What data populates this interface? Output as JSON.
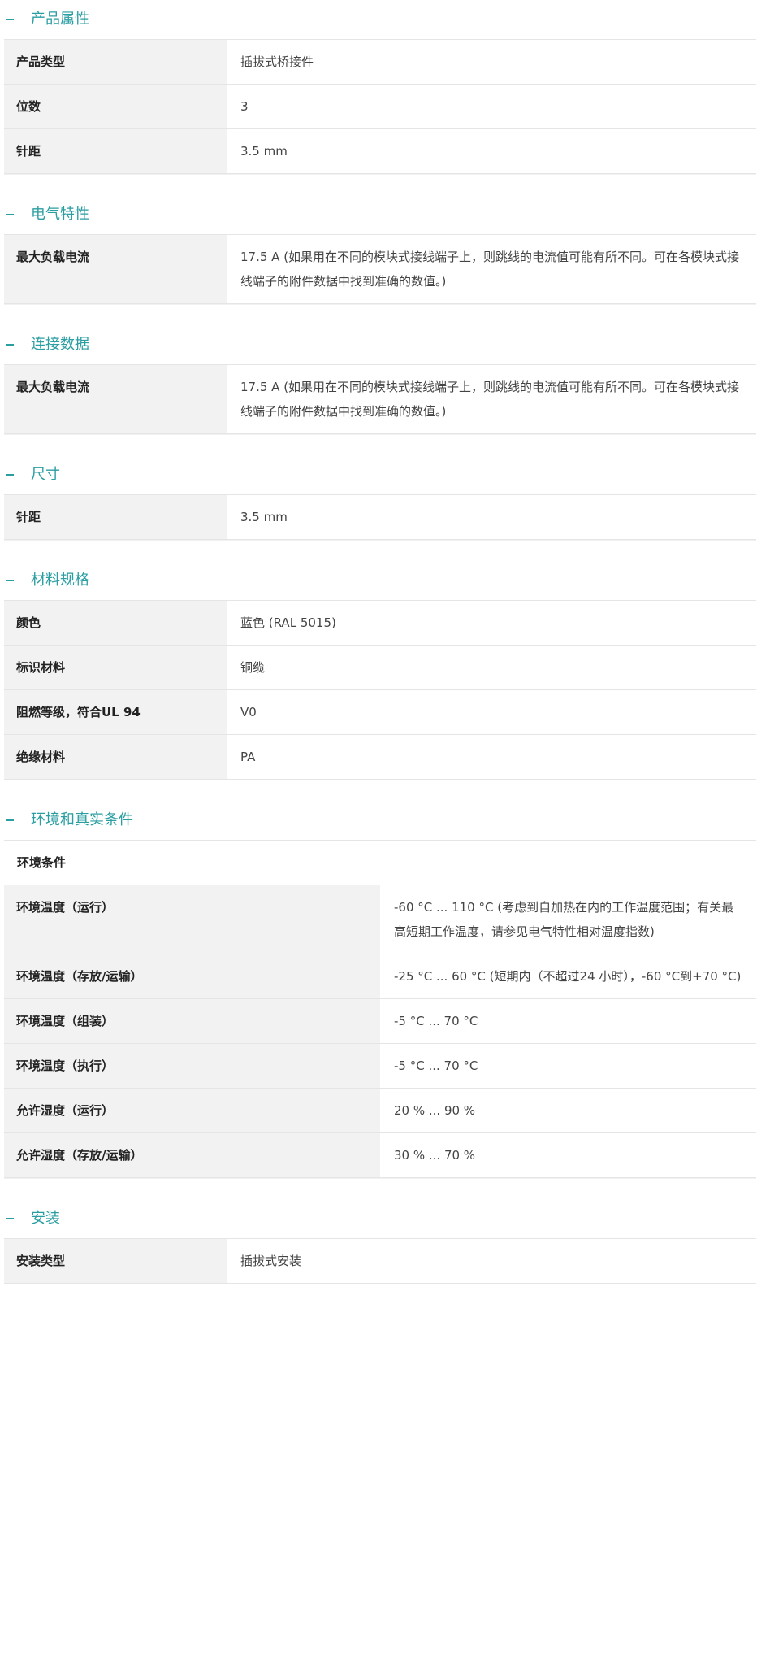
{
  "sections": [
    {
      "title": "产品属性",
      "rows": [
        {
          "label": "产品类型",
          "value": "插拔式桥接件"
        },
        {
          "label": "位数",
          "value": "3"
        },
        {
          "label": "针距",
          "value": "3.5 mm"
        }
      ]
    },
    {
      "title": "电气特性",
      "rows": [
        {
          "label": "最大负载电流",
          "value": "17.5 A (如果用在不同的模块式接线端子上，则跳线的电流值可能有所不同。可在各模块式接线端子的附件数据中找到准确的数值。)"
        }
      ]
    },
    {
      "title": "连接数据",
      "rows": [
        {
          "label": "最大负载电流",
          "value": "17.5 A (如果用在不同的模块式接线端子上，则跳线的电流值可能有所不同。可在各模块式接线端子的附件数据中找到准确的数值。)"
        }
      ]
    },
    {
      "title": "尺寸",
      "rows": [
        {
          "label": "针距",
          "value": "3.5 mm"
        }
      ]
    },
    {
      "title": "材料规格",
      "rows": [
        {
          "label": "颜色",
          "value": "蓝色 (RAL 5015)"
        },
        {
          "label": "标识材料",
          "value": "铜缆"
        },
        {
          "label": "阻燃等级，符合UL 94",
          "value": "V0"
        },
        {
          "label": "绝缘材料",
          "value": "PA"
        }
      ]
    },
    {
      "title": "环境和真实条件",
      "subheading": "环境条件",
      "rows": [
        {
          "label": "环境温度（运行）",
          "value": "-60 °C ... 110 °C (考虑到自加热在内的工作温度范围；有关最高短期工作温度，请参见电气特性相对温度指数)"
        },
        {
          "label": "环境温度（存放/运输）",
          "value": "-25 °C ... 60 °C (短期内（不超过24 小时），-60 °C到+70 °C)"
        },
        {
          "label": "环境温度（组装）",
          "value": "-5 °C ... 70 °C"
        },
        {
          "label": "环境温度（执行）",
          "value": "-5 °C ... 70 °C"
        },
        {
          "label": "允许湿度（运行）",
          "value": "20 % ... 90 %"
        },
        {
          "label": "允许湿度（存放/运输）",
          "value": "30 % ... 70 %"
        }
      ]
    },
    {
      "title": "安装",
      "rows": [
        {
          "label": "安装类型",
          "value": "插拔式安装"
        }
      ]
    }
  ],
  "colors": {
    "accent": "#2b9ea2",
    "label_bg": "#f2f2f2",
    "border": "#e5e5e5"
  },
  "icons": {
    "section_toggle": "collapse-minus-icon"
  }
}
